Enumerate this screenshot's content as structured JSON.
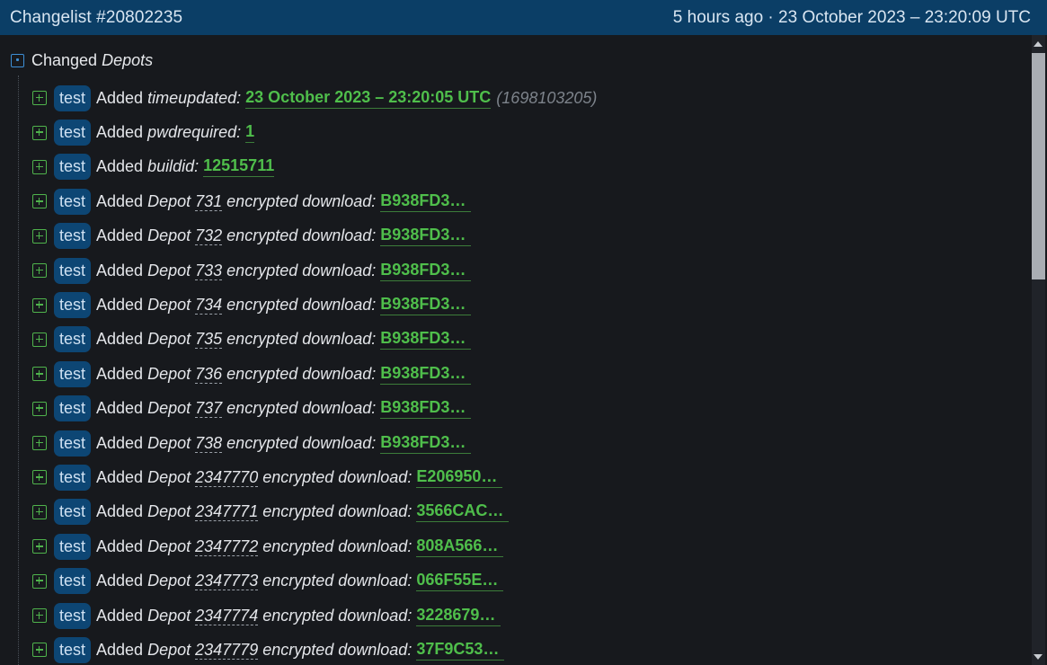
{
  "header": {
    "title": "Changelist #20802235",
    "timestamp": "5 hours ago · 23 October 2023 – 23:20:09 UTC"
  },
  "section": {
    "prefix": "Changed ",
    "name": "Depots"
  },
  "rows": [
    {
      "tag": "test",
      "verb": "Added",
      "key": "timeupdated:",
      "value": "23 October 2023 – 23:20:05 UTC",
      "extra": "(1698103205)"
    },
    {
      "tag": "test",
      "verb": "Added",
      "key": "pwdrequired:",
      "value": "1"
    },
    {
      "tag": "test",
      "verb": "Added",
      "key": "buildid:",
      "value": "12515711"
    },
    {
      "tag": "test",
      "verb": "Added",
      "pre": "Depot",
      "depot": "731",
      "post": "encrypted download:",
      "value": "B938FD3…"
    },
    {
      "tag": "test",
      "verb": "Added",
      "pre": "Depot",
      "depot": "732",
      "post": "encrypted download:",
      "value": "B938FD3…"
    },
    {
      "tag": "test",
      "verb": "Added",
      "pre": "Depot",
      "depot": "733",
      "post": "encrypted download:",
      "value": "B938FD3…"
    },
    {
      "tag": "test",
      "verb": "Added",
      "pre": "Depot",
      "depot": "734",
      "post": "encrypted download:",
      "value": "B938FD3…"
    },
    {
      "tag": "test",
      "verb": "Added",
      "pre": "Depot",
      "depot": "735",
      "post": "encrypted download:",
      "value": "B938FD3…"
    },
    {
      "tag": "test",
      "verb": "Added",
      "pre": "Depot",
      "depot": "736",
      "post": "encrypted download:",
      "value": "B938FD3…"
    },
    {
      "tag": "test",
      "verb": "Added",
      "pre": "Depot",
      "depot": "737",
      "post": "encrypted download:",
      "value": "B938FD3…"
    },
    {
      "tag": "test",
      "verb": "Added",
      "pre": "Depot",
      "depot": "738",
      "post": "encrypted download:",
      "value": "B938FD3…"
    },
    {
      "tag": "test",
      "verb": "Added",
      "pre": "Depot",
      "depot": "2347770",
      "post": "encrypted download:",
      "value": "E206950…"
    },
    {
      "tag": "test",
      "verb": "Added",
      "pre": "Depot",
      "depot": "2347771",
      "post": "encrypted download:",
      "value": "3566CAC…"
    },
    {
      "tag": "test",
      "verb": "Added",
      "pre": "Depot",
      "depot": "2347772",
      "post": "encrypted download:",
      "value": "808A566…"
    },
    {
      "tag": "test",
      "verb": "Added",
      "pre": "Depot",
      "depot": "2347773",
      "post": "encrypted download:",
      "value": "066F55E…"
    },
    {
      "tag": "test",
      "verb": "Added",
      "pre": "Depot",
      "depot": "2347774",
      "post": "encrypted download:",
      "value": "3228679…"
    },
    {
      "tag": "test",
      "verb": "Added",
      "pre": "Depot",
      "depot": "2347779",
      "post": "encrypted download:",
      "value": "37F9C53…"
    }
  ],
  "icons": {
    "collapse": "collapse-square-icon",
    "added": "plus-square-icon"
  },
  "colors": {
    "header_bg": "#0b3e66",
    "page_bg": "#17191d",
    "badge_bg": "#0d4674",
    "value_green": "#4fbe4b",
    "added_icon": "#4fb34c",
    "collapse_icon": "#3d8fd6"
  }
}
